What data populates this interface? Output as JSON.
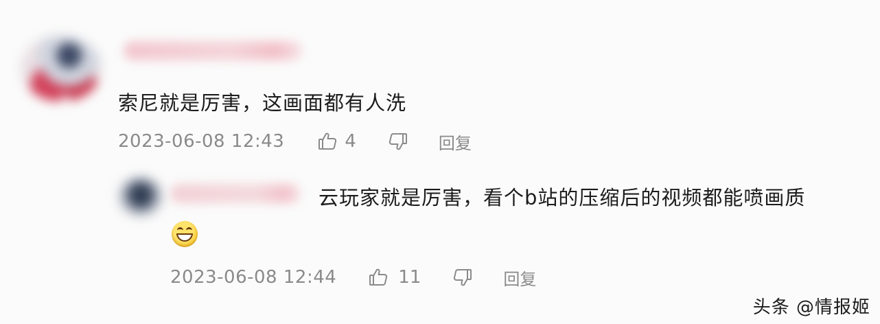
{
  "comments": [
    {
      "text": "索尼就是厉害，这画面都有人洗",
      "timestamp": "2023-06-08 12:43",
      "like_count": "4",
      "reply_label": "回复"
    }
  ],
  "replies": [
    {
      "text": "云玩家就是厉害，看个b站的压缩后的视频都能喷画质",
      "emoji": "grinning-face",
      "timestamp": "2023-06-08 12:44",
      "like_count": "11",
      "reply_label": "回复"
    }
  ],
  "icons": {
    "like": "thumbs-up-icon",
    "dislike": "thumbs-down-icon"
  },
  "watermark": {
    "text": "头条 @情报姬"
  }
}
